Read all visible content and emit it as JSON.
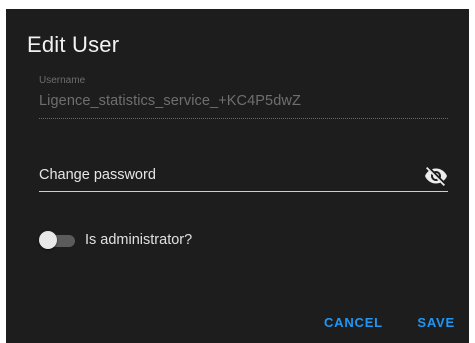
{
  "dialog": {
    "title": "Edit User",
    "username": {
      "label": "Username",
      "value": "Ligence_statistics_service_+KC4P5dwZ"
    },
    "password": {
      "label": "Change password",
      "visibility_icon": "eye-off-icon"
    },
    "admin_toggle": {
      "label": "Is administrator?",
      "checked": false
    },
    "actions": {
      "cancel_label": "CANCEL",
      "save_label": "SAVE"
    }
  },
  "colors": {
    "dialog_background": "#1d1d1d",
    "accent": "#2196f3"
  }
}
